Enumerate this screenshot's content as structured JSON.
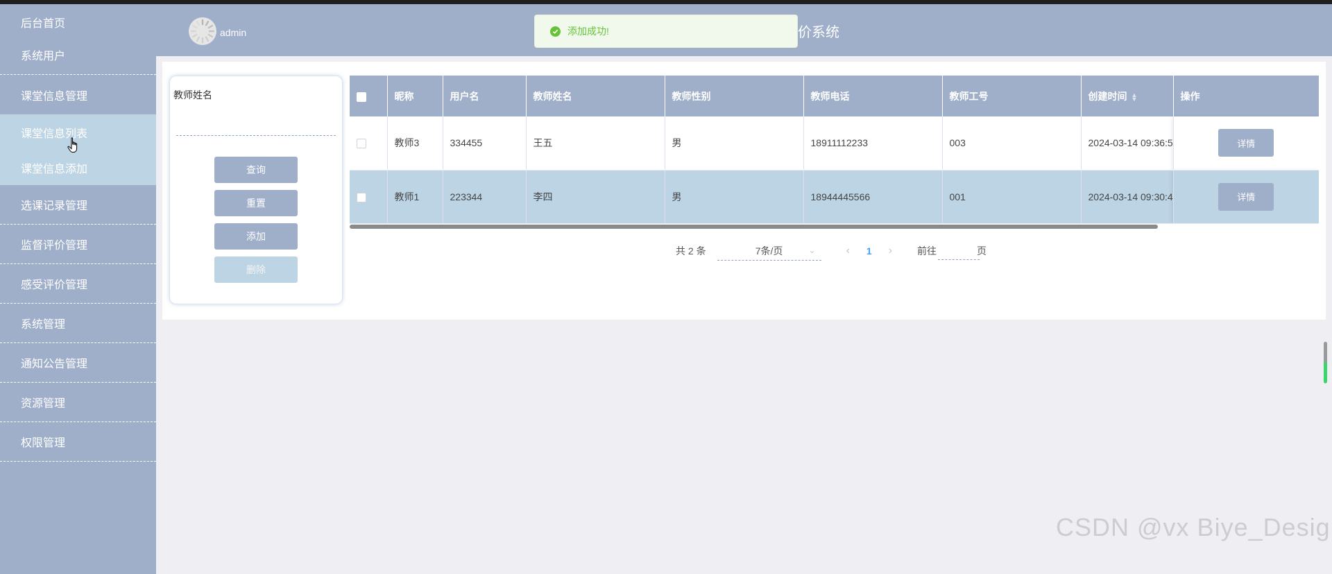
{
  "header": {
    "username": "admin",
    "title_visible": "价系统"
  },
  "toast": {
    "message": "添加成功!",
    "type": "success",
    "color": "#67c23a"
  },
  "sidebar": {
    "items": [
      {
        "label": "后台首页"
      },
      {
        "label": "系统用户"
      },
      {
        "label": "课堂信息管理"
      },
      {
        "label": "选课记录管理"
      },
      {
        "label": "监督评价管理"
      },
      {
        "label": "感受评价管理"
      },
      {
        "label": "系统管理"
      },
      {
        "label": "通知公告管理"
      },
      {
        "label": "资源管理"
      },
      {
        "label": "权限管理"
      }
    ],
    "submenu": [
      {
        "label": "课堂信息列表"
      },
      {
        "label": "课堂信息添加"
      }
    ]
  },
  "search": {
    "label": "教师姓名",
    "value": "",
    "buttons": {
      "query": "查询",
      "reset": "重置",
      "add": "添加",
      "delete": "删除"
    }
  },
  "table": {
    "headers": {
      "nickname": "昵称",
      "username": "用户名",
      "teacher_name": "教师姓名",
      "teacher_gender": "教师性别",
      "teacher_phone": "教师电话",
      "teacher_id": "教师工号",
      "created_at": "创建时间",
      "actions": "操作"
    },
    "rows": [
      {
        "nickname": "教师3",
        "username": "334455",
        "teacher_name": "王五",
        "teacher_gender": "男",
        "teacher_phone": "18911112233",
        "teacher_id": "003",
        "created_at": "2024-03-14 09:36:5",
        "action": "详情"
      },
      {
        "nickname": "教师1",
        "username": "223344",
        "teacher_name": "李四",
        "teacher_gender": "男",
        "teacher_phone": "18944445566",
        "teacher_id": "001",
        "created_at": "2024-03-14 09:30:4",
        "action": "详情"
      }
    ]
  },
  "pagination": {
    "total_text": "共 2 条",
    "page_size": "7条/页",
    "current_page": "1",
    "goto_label": "前往",
    "goto_suffix": "页",
    "goto_value": ""
  },
  "watermark": "CSDN @vx  Biye_Design",
  "colors": {
    "primary": "#9faec9",
    "highlight": "#bcd4e4",
    "background": "#eeeef3"
  }
}
